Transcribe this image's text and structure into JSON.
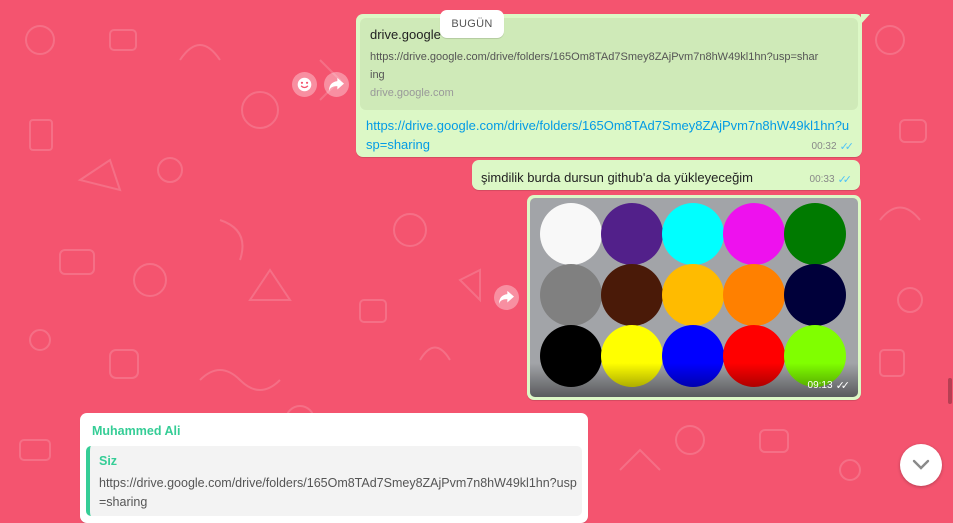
{
  "date_chip": "BUGÜN",
  "message1": {
    "preview_title": "drive.google",
    "preview_desc": "https://drive.google.com/drive/folders/165Om8TAd7Smey8ZAjPvm7n8hW49kl1hn?usp=sharing",
    "preview_domain": "drive.google.com",
    "link": "https://drive.google.com/drive/folders/165Om8TAd7Smey8ZAjPvm7n8hW49kl1hn?usp=sharing",
    "time": "00:32"
  },
  "message2": {
    "text": "şimdilik burda dursun github'a da yükleyeceğim",
    "time": "00:33"
  },
  "message3": {
    "time": "09:13",
    "circles": [
      "#f8f8f8",
      "#52208a",
      "#00ffff",
      "#ee11ee",
      "#007a00",
      "#808080",
      "#4a1a08",
      "#ffbb00",
      "#ff8000",
      "#00003a",
      "#000000",
      "#ffff00",
      "#0000ff",
      "#ff0000",
      "#80ff00"
    ]
  },
  "incoming": {
    "sender": "Muhammed Ali",
    "quote_author": "Siz",
    "quote_text": "https://drive.google.com/drive/folders/165Om8TAd7Smey8ZAjPvm7n8hW49kl1hn?usp=sharing"
  },
  "icons": {
    "emoji": "smiley-icon",
    "forward": "forward-icon",
    "scroll": "chevron-down-icon",
    "read": "double-check-icon"
  },
  "colors": {
    "background": "#f4546f",
    "outgoing": "#dcf8c6",
    "incoming": "#ffffff",
    "link": "#039be5",
    "sender": "#35cd96"
  }
}
